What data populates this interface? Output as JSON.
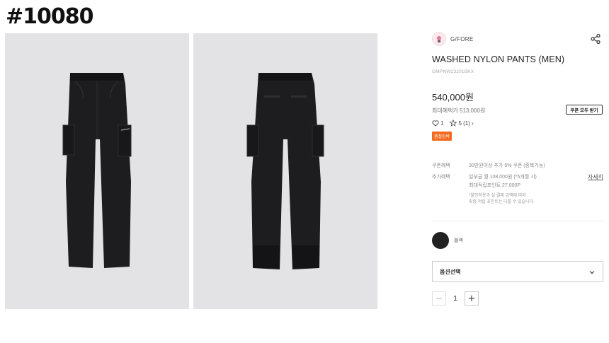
{
  "overlay": {
    "tag": "#10080"
  },
  "gallery": {
    "images": [
      {
        "name": "front-view",
        "color": "#1d1d1f"
      },
      {
        "name": "back-view",
        "color": "#1d1d1f"
      }
    ],
    "background": "#e3e3e6"
  },
  "product": {
    "brand": "G/FORE",
    "title": "WASHED NYLON PANTS (MEN)",
    "code": "GMPNW23201BKX",
    "price": "540,000원",
    "max_benefit": "최대혜택가 513,000원",
    "coupon_button": "쿠폰 모두 받기",
    "likes": "1",
    "rating": "5 (1) ›",
    "badge": "품절임박",
    "accent_color": "#f26a21"
  },
  "benefits": {
    "coupon_label": "쿠폰혜택",
    "coupon_value": "30만원이상 추가 5% 쿠폰 (중복가능)",
    "extra_label": "추가혜택",
    "extra_line1": "일부금 월 108,000원 (*5개월 시)",
    "extra_line2": "최대적립포인트 27,000P",
    "note_line1": "*할인적용과 실 결제 금액에 따라",
    "note_line2": "최종 적립 포인트는 다를 수 있습니다.",
    "detail_link": "자세히"
  },
  "options": {
    "color_name": "블랙",
    "swatch_color": "#222222",
    "select_placeholder": "옵션선택",
    "quantity": "1",
    "minus": "−",
    "plus": "+"
  }
}
